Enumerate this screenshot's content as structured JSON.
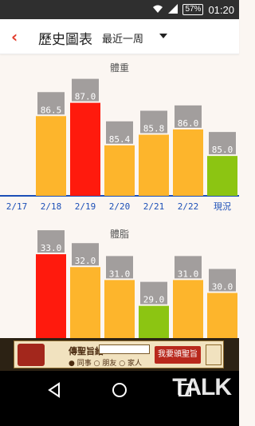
{
  "status_bar": {
    "time": "01:20",
    "battery": "57%"
  },
  "header": {
    "back_icon": "chevron-left-icon",
    "title": "歷史圖表",
    "period": "最近一周"
  },
  "colors": {
    "high": "#ff1a0d",
    "normal": "#fdb52c",
    "low": "#8cc512",
    "label_bg": "#a29e9d",
    "date_blue": "#1c4fb7"
  },
  "x_labels": [
    "2/17",
    "2/18",
    "2/19",
    "2/20",
    "2/21",
    "2/22",
    "現況"
  ],
  "chart_data": [
    {
      "type": "bar",
      "title": "體重",
      "categories": [
        "2/17",
        "2/18",
        "2/19",
        "2/20",
        "2/21",
        "2/22",
        "現況"
      ],
      "values": [
        null,
        86.5,
        87.0,
        85.4,
        85.8,
        86.0,
        85.0
      ],
      "labels": [
        "",
        "86.5",
        "87.0",
        "85.4",
        "85.8",
        "86.0",
        "85.0"
      ],
      "bar_colors": [
        "",
        "normal",
        "high",
        "normal",
        "normal",
        "normal",
        "low"
      ],
      "ylim": [
        83.5,
        87.5
      ]
    },
    {
      "type": "bar",
      "title": "體脂",
      "categories": [
        "2/17",
        "2/18",
        "2/19",
        "2/20",
        "2/21",
        "2/22",
        "現況"
      ],
      "values": [
        null,
        33.0,
        32.0,
        31.0,
        29.0,
        31.0,
        30.0
      ],
      "labels": [
        "",
        "33.0",
        "32.0",
        "31.0",
        "29.0",
        "31.0",
        "30.0"
      ],
      "bar_colors": [
        "",
        "high",
        "normal",
        "normal",
        "low",
        "normal",
        "normal"
      ],
      "ylim": [
        26.5,
        33.5
      ]
    }
  ],
  "ad": {
    "prompt": "傳聖旨給",
    "options": [
      "同事",
      "朋友",
      "家人"
    ],
    "button": "我要頒聖旨"
  },
  "nav": {
    "back": "back-icon",
    "home": "home-icon",
    "recents": "recents-icon"
  },
  "watermark": "TALK"
}
